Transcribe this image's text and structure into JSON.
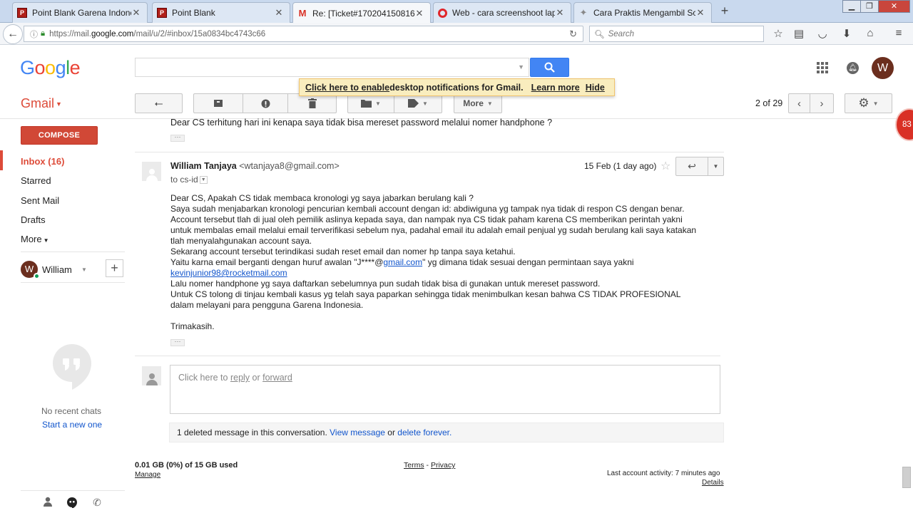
{
  "browser": {
    "tabs": [
      {
        "title": "Point Blank Garena Indone...",
        "favicon": "point-blank"
      },
      {
        "title": "Point Blank",
        "favicon": "point-blank"
      },
      {
        "title": "Re: [Ticket#1702041508168...",
        "favicon": "gmail"
      },
      {
        "title": "Web - cara screenshoot lap...",
        "favicon": "opera"
      },
      {
        "title": "Cara Praktis Mengambil Sc...",
        "favicon": "puzzle"
      }
    ],
    "url_prefix": "https://mail.",
    "url_domain": "google.com",
    "url_rest": "/mail/u/2/#inbox/15a0834bc4743c66",
    "search_placeholder": "Search"
  },
  "gmail": {
    "logo": [
      "G",
      "o",
      "o",
      "g",
      "l",
      "e"
    ],
    "logo_colors": [
      "#4285f4",
      "#ea4335",
      "#fbbc05",
      "#4285f4",
      "#34a853",
      "#ea4335"
    ],
    "brand_red": "#dd4b39",
    "title": "Gmail",
    "avatar_letter": "W"
  },
  "notification": {
    "enable_link": "Click here to enable",
    "text": " desktop notifications for Gmail.",
    "learn_more": "Learn more",
    "hide": "Hide"
  },
  "toolbar": {
    "more_label": "More",
    "pager": "2 of 29"
  },
  "sidebar": {
    "compose": "COMPOSE",
    "items": [
      {
        "label": "Inbox (16)"
      },
      {
        "label": "Starred"
      },
      {
        "label": "Sent Mail"
      },
      {
        "label": "Drafts"
      },
      {
        "label": "More"
      }
    ],
    "hangouts_user": "William",
    "no_recent": "No recent chats",
    "start_new": "Start a new one"
  },
  "thread": {
    "previous_snippet": "Dear CS terhitung hari ini kenapa saya tidak bisa mereset password melalui nomer handphone ?",
    "message": {
      "sender_name": "William Tanjaya",
      "sender_email": "<wtanjaya8@gmail.com>",
      "to": "to cs-id",
      "date": "15 Feb (1 day ago)",
      "lines": [
        "Dear CS, Apakah CS tidak membaca kronologi yg saya jabarkan berulang kali ?",
        "Saya sudah menjabarkan kronologi pencurian kembali account dengan id: abdiwiguna yg tampak nya tidak di respon CS dengan benar.",
        "Account tersebut tlah di jual oleh pemilik aslinya kepada saya, dan nampak nya CS tidak paham karena CS memberikan perintah yakni",
        "untuk membalas email melalui email terverifikasi sebelum nya, padahal email itu adalah email penjual yg sudah berulang kali saya katakan",
        "tlah menyalahgunakan account saya.",
        "Sekarang account tersebut terindikasi sudah reset email dan nomer hp tanpa saya ketahui."
      ],
      "line7_pre": "Yaitu karna email berganti dengan huruf awalan \"J****@",
      "line7_link": "gmail.com",
      "line7_post": "\" yg dimana tidak sesuai dengan permintaan saya yakni",
      "line8_link": "kevinjunior98@rocketmail.com",
      "lines_after": [
        "Lalu nomer handphone yg saya daftarkan sebelumnya pun sudah tidak bisa di gunakan untuk mereset password.",
        "Untuk CS tolong di tinjau kembali kasus yg telah saya paparkan sehingga tidak menimbulkan kesan bahwa CS TIDAK PROFESIONAL",
        "dalam melayani para pengguna Garena Indonesia."
      ],
      "closing": "Trimakasih."
    },
    "reply_pre": "Click here to ",
    "reply_link": "reply",
    "reply_or": " or ",
    "forward_link": "forward",
    "deleted_text": "1 deleted message in this conversation. ",
    "view_message": "View message",
    "deleted_or": " or ",
    "delete_forever": "delete forever."
  },
  "footer": {
    "storage": "0.01 GB (0%) of 15 GB used",
    "manage": "Manage",
    "terms": "Terms",
    "dash": " - ",
    "privacy": "Privacy",
    "last_activity": "Last account activity: 7 minutes ago",
    "details": "Details"
  },
  "badge": "83"
}
